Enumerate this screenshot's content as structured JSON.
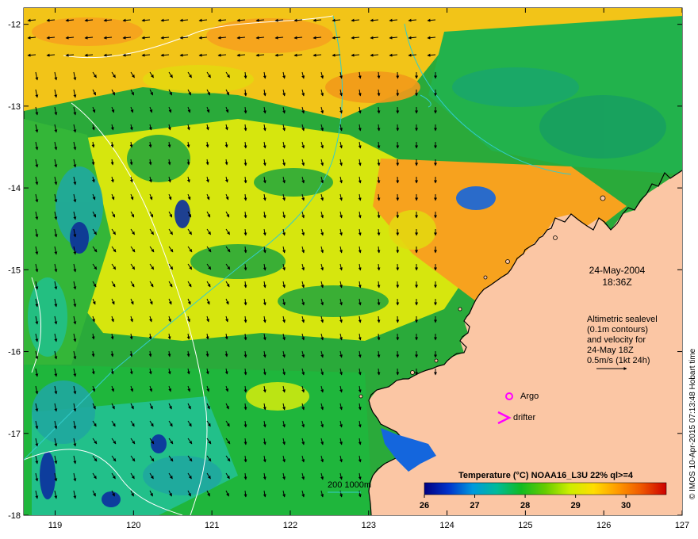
{
  "map": {
    "datetime_line1": "24-May-2004",
    "datetime_line2": "18:36Z",
    "altimetry_note": {
      "line1": "Altimetric sealevel",
      "line2": "(0.1m contours)",
      "line3": "and velocity for",
      "line4": "24-May 18Z",
      "line5": "0.5m/s (1kt 24h)"
    },
    "legend": {
      "argo_label": "Argo",
      "drifter_label": "drifter",
      "argo_color": "#ff00ff",
      "drifter_color": "#ff00ff"
    },
    "isobath_label": "200  1000m",
    "isobath_color": "#33cccc",
    "land_color": "#fbc6a4",
    "credit": "© IMOS 10-Apr-2015 07:13:48 Hobart time",
    "x_axis": {
      "ticks": [
        "119",
        "120",
        "121",
        "122",
        "123",
        "124",
        "125",
        "126",
        "127"
      ],
      "range": [
        118.6,
        127
      ]
    },
    "y_axis": {
      "ticks": [
        "-12",
        "-13",
        "-14",
        "-15",
        "-16",
        "-17",
        "-18"
      ],
      "range": [
        -18,
        -11.8
      ]
    }
  },
  "colorbar": {
    "title": "Temperature (°C) NOAA16_L3U 22% ql>=4",
    "ticks": [
      "26",
      "27",
      "28",
      "29",
      "30"
    ],
    "range": [
      26,
      30.8
    ],
    "colors": [
      "#000080",
      "#0033cc",
      "#0099dd",
      "#00bb99",
      "#11bb22",
      "#66cc00",
      "#ccee00",
      "#ffdd00",
      "#ff9900",
      "#ee5500",
      "#cc0000"
    ]
  }
}
